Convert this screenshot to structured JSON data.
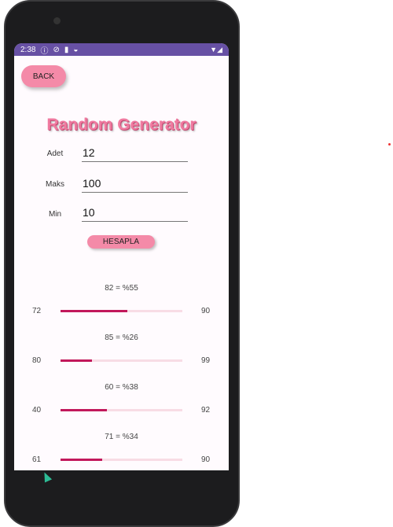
{
  "status_bar": {
    "time": "2:38",
    "icons": [
      "info-icon",
      "shield-icon",
      "sd-card-icon",
      "face-icon"
    ],
    "right_icons": [
      "wifi-icon",
      "signal-icon"
    ],
    "color": "#6750a4"
  },
  "back_label": "BACK",
  "title": "Random Generator",
  "fields": [
    {
      "label": "Adet",
      "value": "12"
    },
    {
      "label": "Maks",
      "value": "100"
    },
    {
      "label": "Min",
      "value": "10"
    }
  ],
  "calc_label": "HESAPLA",
  "results": [
    {
      "label": "82 = %55",
      "min": "72",
      "max": "90",
      "progress": 55
    },
    {
      "label": "85 = %26",
      "min": "80",
      "max": "99",
      "progress": 26
    },
    {
      "label": "60 = %38",
      "min": "40",
      "max": "92",
      "progress": 38
    },
    {
      "label": "71 = %34",
      "min": "61",
      "max": "90",
      "progress": 34
    }
  ],
  "accent": "#f48aa8",
  "bar_color": "#c2185b"
}
